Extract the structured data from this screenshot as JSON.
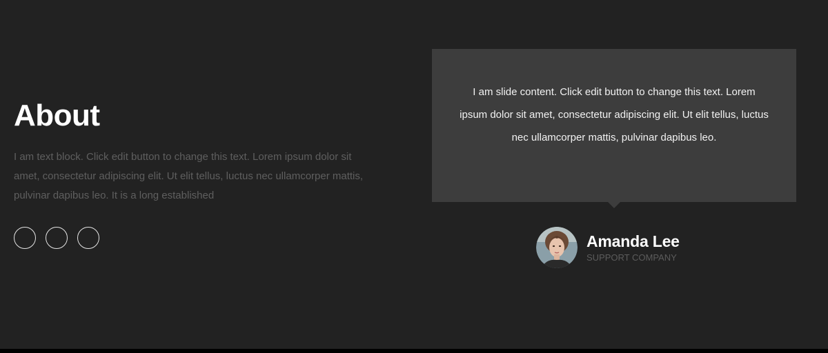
{
  "about": {
    "title": "About",
    "text": "I am text block. Click edit button to change this text. Lorem ipsum dolor sit amet, consectetur adipiscing elit. Ut elit tellus, luctus nec ullamcorper mattis, pulvinar dapibus leo. It is a long established"
  },
  "social": {
    "icons": [
      "social-circle",
      "social-circle",
      "social-circle"
    ]
  },
  "testimonial": {
    "content": "I am slide content. Click edit button to change this text. Lorem ipsum dolor sit amet, consectetur adipiscing elit. Ut elit tellus, luctus nec ullamcorper mattis, pulvinar dapibus leo.",
    "author_name": "Amanda Lee",
    "author_role": "SUPPORT COMPANY"
  },
  "colors": {
    "background": "#222222",
    "card": "#3d3d3d",
    "muted_text": "#5f5f5f",
    "heading": "#ffffff"
  }
}
